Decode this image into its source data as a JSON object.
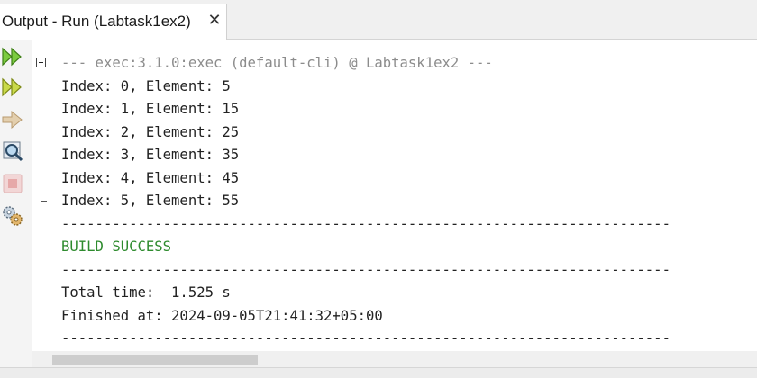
{
  "tab": {
    "title": "Output - Run (Labtask1ex2)",
    "close_glyph": "✕"
  },
  "toolbar": {
    "icons": [
      "rerun-icon",
      "rerun-with-options-icon",
      "run-again-icon",
      "inspect-icon",
      "stop-icon",
      "settings-icon"
    ]
  },
  "output": {
    "header": "--- exec:3.1.0:exec (default-cli) @ Labtask1ex2 ---",
    "lines": [
      "Index: 0, Element: 5",
      "Index: 1, Element: 15",
      "Index: 2, Element: 25",
      "Index: 3, Element: 35",
      "Index: 4, Element: 45",
      "Index: 5, Element: 55"
    ],
    "separator": "------------------------------------------------------------------------",
    "build_status": "BUILD SUCCESS",
    "total_time": "Total time:  1.525 s",
    "finished_at": "Finished at: 2024-09-05T21:41:32+05:00"
  },
  "colors": {
    "success": "#2e8b2e",
    "header_gray": "#8c8c8c",
    "text": "#222222"
  }
}
